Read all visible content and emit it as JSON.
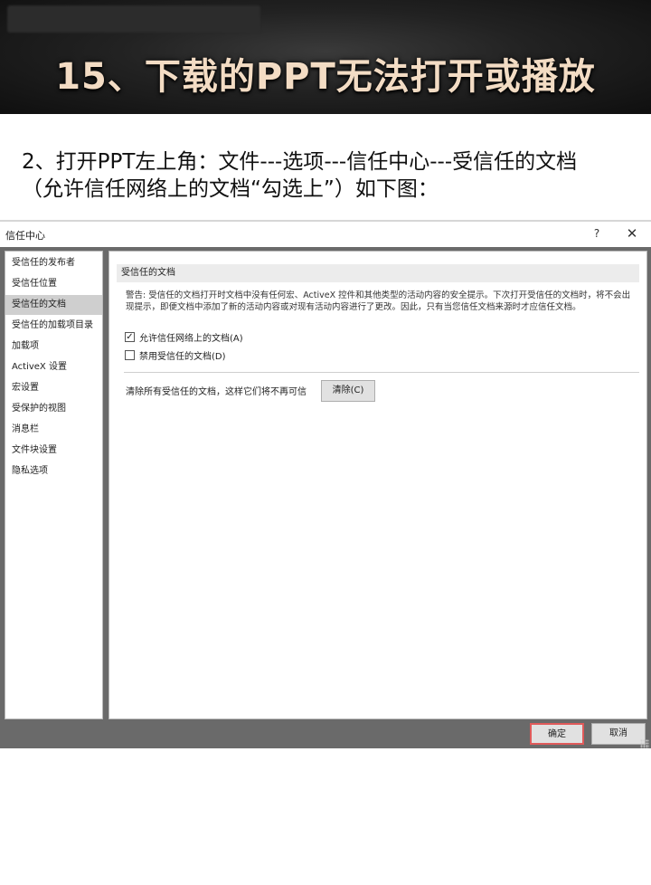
{
  "banner": {
    "title": "15、下载的PPT无法打开或播放"
  },
  "instruction": {
    "text": "2、打开PPT左上角：文件---选项---信任中心---受信任的文档（允许信任网络上的文档“勾选上”）如下图："
  },
  "dialog": {
    "title": "信任中心",
    "help_symbol": "?",
    "close_symbol": "✕",
    "sidebar": {
      "items": [
        {
          "label": "受信任的发布者",
          "selected": false
        },
        {
          "label": "受信任位置",
          "selected": false
        },
        {
          "label": "受信任的文档",
          "selected": true
        },
        {
          "label": "受信任的加载项目录",
          "selected": false
        },
        {
          "label": "加载项",
          "selected": false
        },
        {
          "label": "ActiveX 设置",
          "selected": false
        },
        {
          "label": "宏设置",
          "selected": false
        },
        {
          "label": "受保护的视图",
          "selected": false
        },
        {
          "label": "消息栏",
          "selected": false
        },
        {
          "label": "文件块设置",
          "selected": false
        },
        {
          "label": "隐私选项",
          "selected": false
        }
      ]
    },
    "content": {
      "section_header": "受信任的文档",
      "warning": "警告: 受信任的文档打开时文档中没有任何宏、ActiveX 控件和其他类型的活动内容的安全提示。下次打开受信任的文档时，将不会出现提示，即便文档中添加了新的活动内容或对现有活动内容进行了更改。因此，只有当您信任文档来源时才应信任文档。",
      "checkboxes": [
        {
          "label": "允许信任网络上的文档(A)",
          "checked": true,
          "mark": "✓"
        },
        {
          "label": "禁用受信任的文档(D)",
          "checked": false,
          "mark": ""
        }
      ],
      "clear_text": "清除所有受信任的文档，这样它们将不再可信",
      "clear_button": "清除(C)"
    },
    "footer": {
      "ok_label": "确定",
      "cancel_label": "取消"
    }
  },
  "colors": {
    "banner_text": "#f3dcc4",
    "ok_button_border": "#e05a5a",
    "dialog_background": "#6a6a6a"
  }
}
